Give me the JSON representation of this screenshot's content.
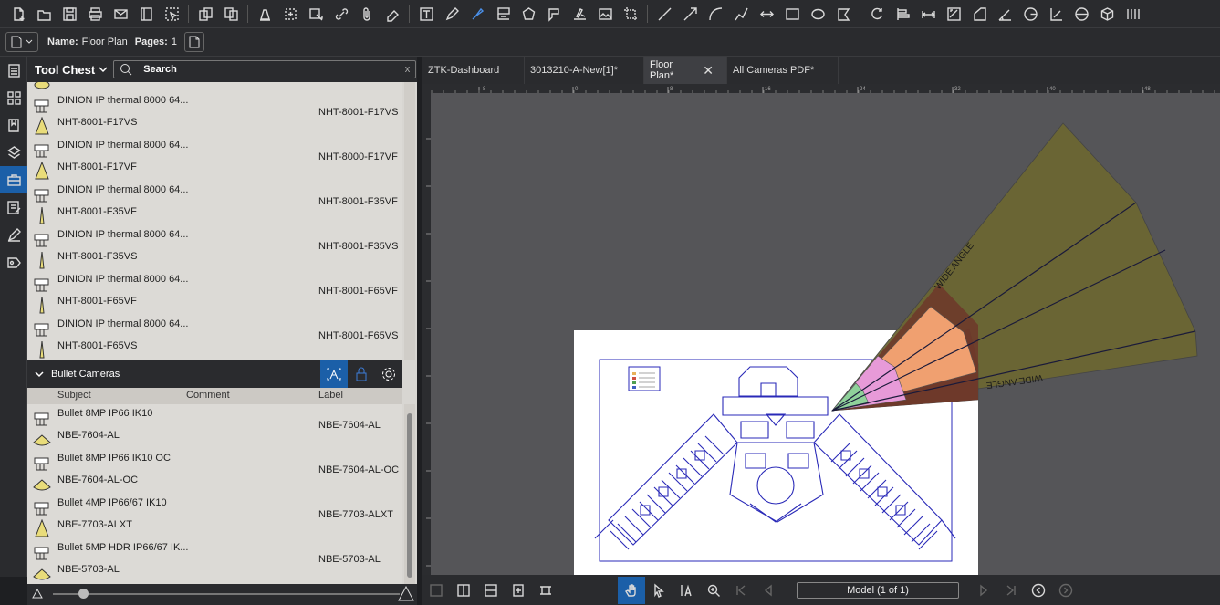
{
  "toolbar": {
    "icons": [
      "new-document-icon",
      "open-folder-icon",
      "save-icon",
      "print-icon",
      "email-icon",
      "panel-icon",
      "select-icon",
      "sep",
      "insert-page-icon",
      "replace-page-icon",
      "sep",
      "highlight-icon",
      "stamp-icon",
      "snapshot-icon",
      "link-icon",
      "attachment-icon",
      "eraser-icon",
      "sep",
      "text-box-icon",
      "pen-icon",
      "highlighter-icon",
      "callout-icon",
      "polygon-icon",
      "arrow-callout-icon",
      "signature-icon",
      "image-icon",
      "crop-icon",
      "sep",
      "line-icon",
      "arrow-icon",
      "arc-icon",
      "polyline-icon",
      "dimension-icon",
      "rectangle-icon",
      "ellipse-icon",
      "cloud-icon",
      "sep",
      "rotate-icon",
      "align-icon",
      "measure-length-icon",
      "measure-area-icon",
      "measure-perimeter-icon",
      "measure-angle-icon",
      "measure-radius-icon",
      "measure-diameter-icon",
      "measure-circle-icon",
      "measure-volume-icon",
      "more-icon"
    ]
  },
  "document": {
    "name_label": "Name:",
    "name_value": "Floor Plan",
    "pages_label": "Pages:",
    "pages_value": "1"
  },
  "tool_chest": {
    "title": "Tool Chest",
    "search_placeholder": "Search",
    "clear_label": "x",
    "thermal_items": [
      {
        "description": "DINION IP thermal 8000 64...",
        "code": "NHT-8001-F17VS",
        "label": "NHT-8001-F17VS"
      },
      {
        "description": "DINION IP thermal 8000 64...",
        "code": "NHT-8001-F17VF",
        "label": "NHT-8000-F17VF"
      },
      {
        "description": "DINION IP thermal 8000 64...",
        "code": "NHT-8001-F35VF",
        "label": "NHT-8001-F35VF"
      },
      {
        "description": "DINION IP thermal 8000 64...",
        "code": "NHT-8001-F35VS",
        "label": "NHT-8001-F35VS"
      },
      {
        "description": "DINION IP thermal 8000 64...",
        "code": "NHT-8001-F65VF",
        "label": "NHT-8001-F65VF"
      },
      {
        "description": "DINION IP thermal 8000 64...",
        "code": "NHT-8001-F65VS",
        "label": "NHT-8001-F65VS"
      }
    ],
    "section_title": "Bullet Cameras",
    "columns": {
      "subject": "Subject",
      "comment": "Comment",
      "label": "Label"
    },
    "bullet_items": [
      {
        "description": "Bullet 8MP IP66 IK10",
        "code": "NBE-7604-AL",
        "label": "NBE-7604-AL"
      },
      {
        "description": "Bullet 8MP IP66 IK10 OC",
        "code": "NBE-7604-AL-OC",
        "label": "NBE-7604-AL-OC"
      },
      {
        "description": "Bullet 4MP IP66/67 IK10",
        "code": "NBE-7703-ALXT",
        "label": "NBE-7703-ALXT"
      },
      {
        "description": "Bullet 5MP HDR IP66/67 IK...",
        "code": "NBE-5703-AL",
        "label": "NBE-5703-AL"
      }
    ]
  },
  "tabs": [
    {
      "label": "ZTK-Dashboard",
      "active": false
    },
    {
      "label": "3013210-A-New[1]*",
      "active": false
    },
    {
      "label": "Floor Plan*",
      "active": true
    },
    {
      "label": "All Cameras PDF*",
      "active": false
    }
  ],
  "ruler": {
    "ticks": [
      "-8",
      "0",
      "8",
      "16",
      "24",
      "32",
      "40",
      "48"
    ]
  },
  "canvas": {
    "fov_label_top": "WIDE ANGLE",
    "fov_label_bottom": "WIDE ANGLE"
  },
  "status": {
    "page_indicator": "Model (1 of 1)"
  },
  "colors": {
    "accent": "#1b5fa8",
    "fov_olive": "#6b6633",
    "fov_brown": "#6e3a2a",
    "fov_orange": "#f0a070",
    "fov_pink": "#e79ad8",
    "fov_green": "#8fd19a",
    "floorplan_blue": "#2a2ab8"
  }
}
